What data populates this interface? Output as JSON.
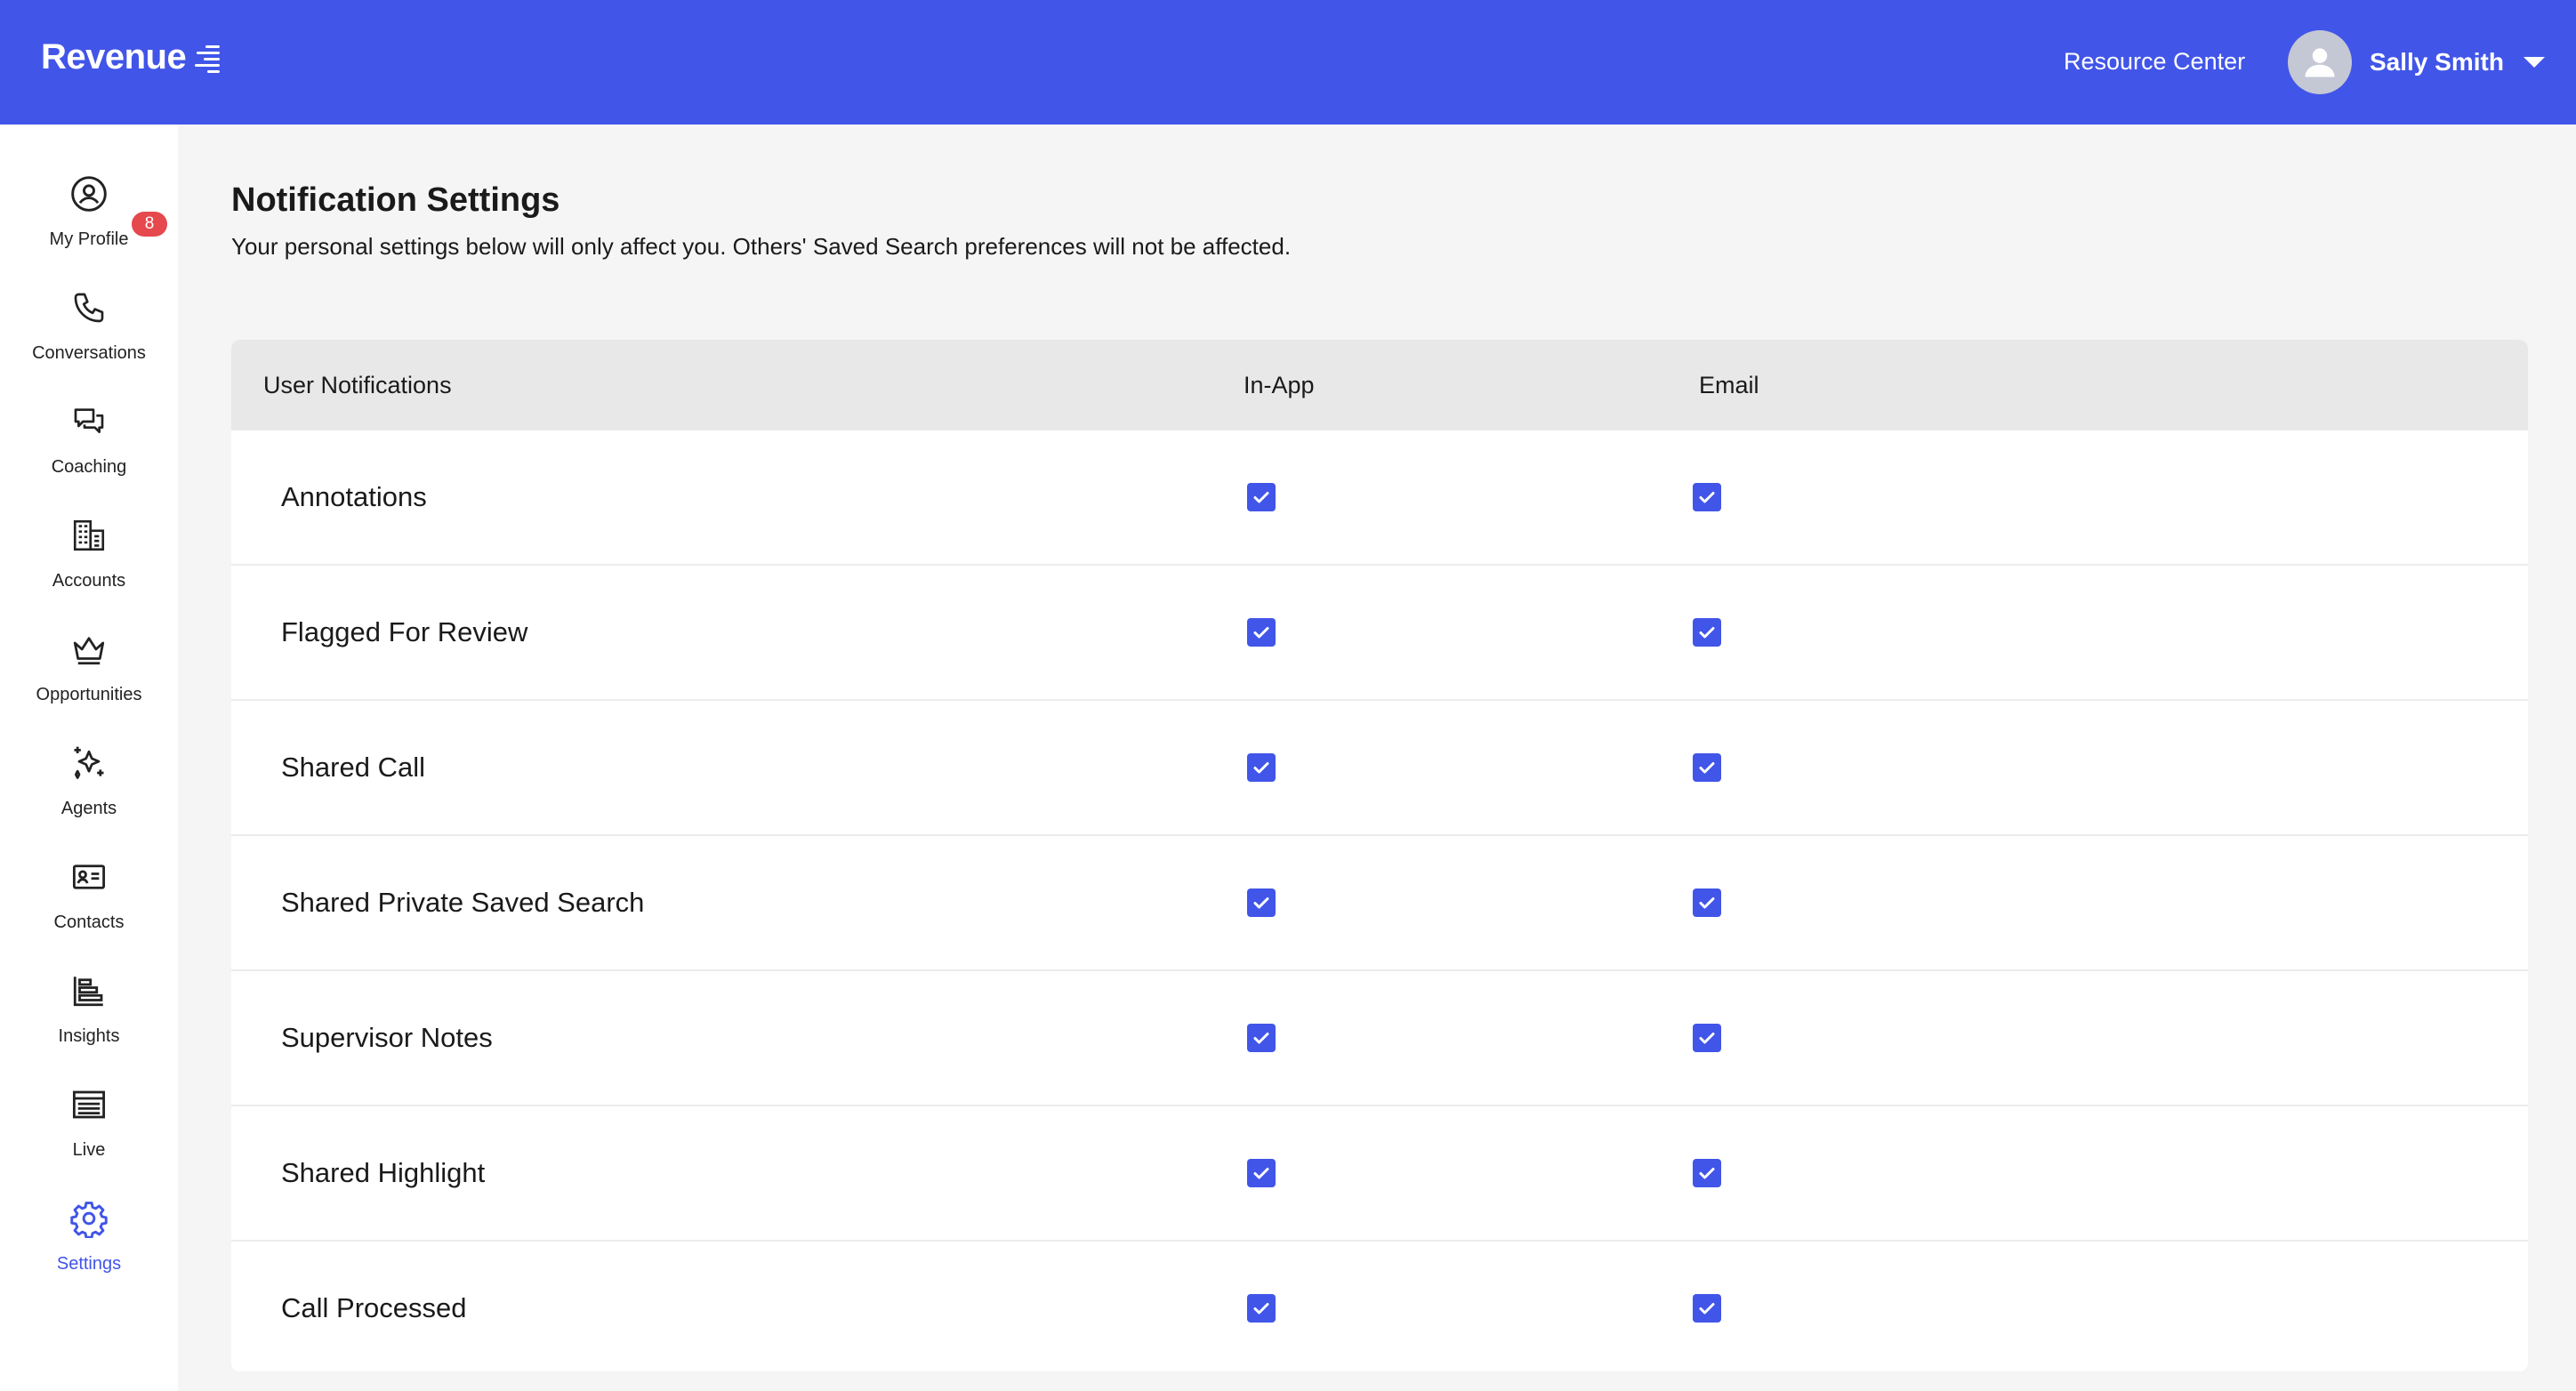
{
  "header": {
    "brand": "Revenue",
    "resource_center": "Resource Center",
    "user_name": "Sally Smith"
  },
  "colors": {
    "brand": "#4155e8",
    "badge": "#e5484d",
    "active": "#4155e8"
  },
  "sidebar": {
    "items": [
      {
        "label": "My Profile",
        "icon": "user-circle-icon",
        "badge": "8"
      },
      {
        "label": "Conversations",
        "icon": "phone-icon"
      },
      {
        "label": "Coaching",
        "icon": "chat-bubbles-icon"
      },
      {
        "label": "Accounts",
        "icon": "buildings-icon"
      },
      {
        "label": "Opportunities",
        "icon": "crown-icon"
      },
      {
        "label": "Agents",
        "icon": "sparkles-icon"
      },
      {
        "label": "Contacts",
        "icon": "contact-card-icon"
      },
      {
        "label": "Insights",
        "icon": "bar-chart-icon"
      },
      {
        "label": "Live",
        "icon": "live-table-icon"
      },
      {
        "label": "Settings",
        "icon": "gear-icon",
        "active": true
      }
    ]
  },
  "main": {
    "title": "Notification Settings",
    "subtitle": "Your personal settings below will only affect you. Others' Saved Search preferences will not be affected.",
    "table": {
      "columns": [
        "User Notifications",
        "In-App",
        "Email"
      ],
      "rows": [
        {
          "label": "Annotations",
          "in_app": true,
          "email": true
        },
        {
          "label": "Flagged For Review",
          "in_app": true,
          "email": true
        },
        {
          "label": "Shared Call",
          "in_app": true,
          "email": true
        },
        {
          "label": "Shared Private Saved Search",
          "in_app": true,
          "email": true
        },
        {
          "label": "Supervisor Notes",
          "in_app": true,
          "email": true
        },
        {
          "label": "Shared Highlight",
          "in_app": true,
          "email": true
        },
        {
          "label": "Call Processed",
          "in_app": true,
          "email": true
        }
      ]
    }
  }
}
